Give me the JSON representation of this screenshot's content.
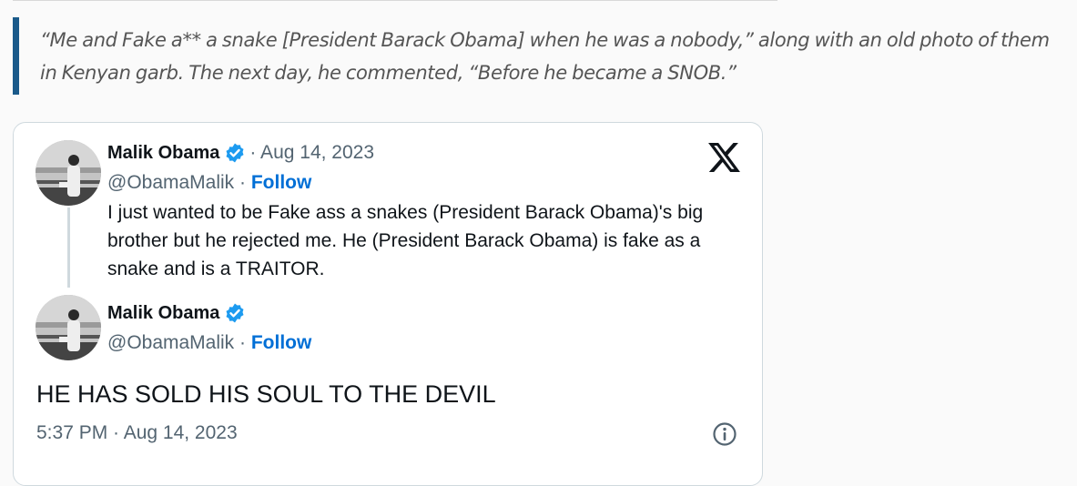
{
  "article": {
    "blockquote": "“Me and Fake a** a snake [President Barack Obama] when he was a nobody,” along with an old photo of them in Kenyan garb. The next day, he commented, “Before he became a SNOB.”"
  },
  "embed": {
    "tweet1": {
      "name": "Malik Obama",
      "date": "· Aug 14, 2023",
      "handle": "@ObamaMalik",
      "separator": " · ",
      "follow": "Follow",
      "text": "I just wanted to be Fake ass a snakes (President Barack Obama)'s big brother but he rejected me. He (President Barack Obama) is fake as a snake and is a TRAITOR."
    },
    "tweet2": {
      "name": "Malik Obama",
      "handle": "@ObamaMalik",
      "separator": " · ",
      "follow": "Follow",
      "text": "HE HAS SOLD HIS SOUL TO THE DEVIL",
      "timestamp": "5:37 PM · Aug 14, 2023"
    },
    "icons": {
      "verified": "verified-badge-icon",
      "platform": "x-logo-icon",
      "info": "info-icon"
    },
    "colors": {
      "follow": "#006fd6",
      "verified": "#1d9bf0",
      "quote_bar": "#1a5a8a"
    }
  }
}
